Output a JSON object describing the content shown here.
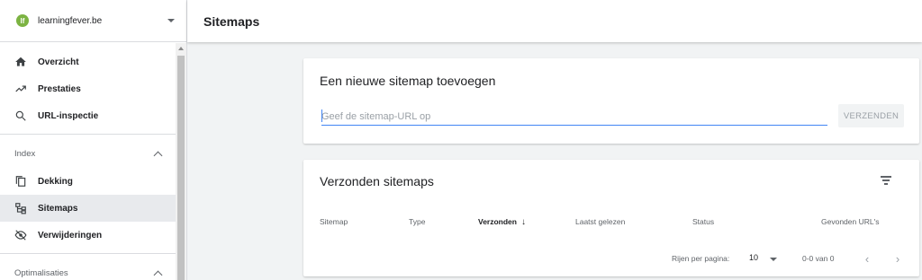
{
  "property": {
    "name": "learningfever.be",
    "logo_text": "lf"
  },
  "header": {
    "title": "Sitemaps"
  },
  "sidebar": {
    "items": [
      {
        "label": "Overzicht",
        "icon": "home-icon"
      },
      {
        "label": "Prestaties",
        "icon": "trending-up-icon"
      },
      {
        "label": "URL-inspectie",
        "icon": "search-icon"
      }
    ],
    "sections": [
      {
        "title": "Index",
        "items": [
          {
            "label": "Dekking",
            "icon": "copy-icon"
          },
          {
            "label": "Sitemaps",
            "icon": "sitemap-icon",
            "active": true
          },
          {
            "label": "Verwijderingen",
            "icon": "visibility-off-icon"
          }
        ]
      },
      {
        "title": "Optimalisaties",
        "items": []
      }
    ]
  },
  "add_sitemap": {
    "title": "Een nieuwe sitemap toevoegen",
    "input_placeholder": "Geef de sitemap-URL op",
    "input_value": "",
    "submit_label": "VERZENDEN"
  },
  "submitted_sitemaps": {
    "title": "Verzonden sitemaps",
    "columns": [
      "Sitemap",
      "Type",
      "Verzonden",
      "Laatst gelezen",
      "Status",
      "Gevonden URL's"
    ],
    "sorted_column": "Verzonden",
    "rows": [],
    "pagination": {
      "rows_per_page_label": "Rijen per pagina:",
      "rows_per_page": "10",
      "range": "0-0 van 0"
    }
  },
  "colors": {
    "accent": "#4285f4",
    "logo": "#7cb342",
    "active_bg": "#e8eaed"
  }
}
